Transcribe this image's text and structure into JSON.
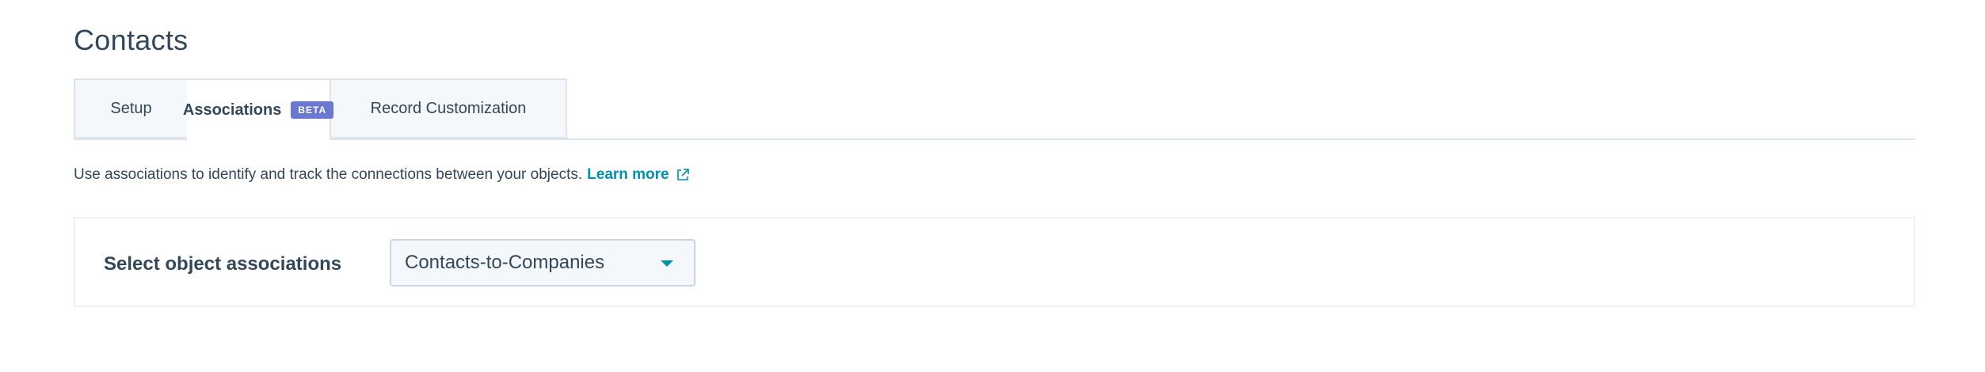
{
  "page": {
    "title": "Contacts"
  },
  "tabs": [
    {
      "label": "Setup",
      "active": false
    },
    {
      "label": "Associations",
      "badge": "BETA",
      "active": true
    },
    {
      "label": "Record Customization",
      "active": false
    }
  ],
  "description": {
    "text": "Use associations to identify and track the connections between your objects.",
    "link_label": "Learn more",
    "link_icon": "external-link-icon"
  },
  "associations": {
    "label": "Select object associations",
    "selected_value": "Contacts-to-Companies",
    "dropdown_icon": "caret-down-icon"
  },
  "colors": {
    "text": "#33475b",
    "link": "#0091ae",
    "badge": "#6a78d1",
    "border": "#dfe3eb",
    "inactive_tab_bg": "#f5f8fa"
  }
}
